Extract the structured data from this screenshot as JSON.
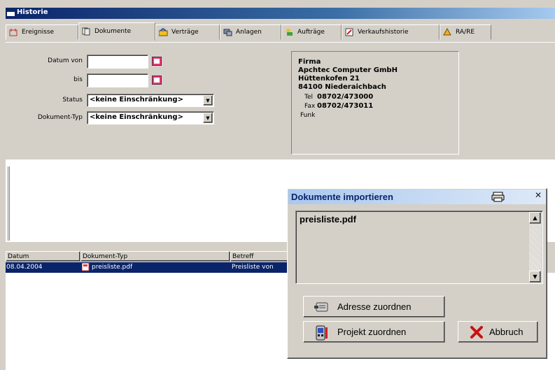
{
  "window": {
    "title": "Historie"
  },
  "tabs": [
    {
      "label": "Ereignisse",
      "icon": "events-icon"
    },
    {
      "label": "Dokumente",
      "icon": "documents-icon"
    },
    {
      "label": "Verträge",
      "icon": "contracts-icon"
    },
    {
      "label": "Anlagen",
      "icon": "assets-icon"
    },
    {
      "label": "Aufträge",
      "icon": "orders-icon"
    },
    {
      "label": "Verkaufshistorie",
      "icon": "sales-history-icon"
    },
    {
      "label": "RA/RE",
      "icon": "invoice-icon"
    }
  ],
  "filters": {
    "date_from_label": "Datum von",
    "date_to_label": "bis",
    "status_label": "Status",
    "doctype_label": "Dokument-Typ",
    "status_value": "<keine Einschränkung>",
    "doctype_value": "<keine Einschränkung>"
  },
  "firma": {
    "label": "Firma",
    "name": "Apchtec Computer GmbH",
    "street": "Hüttenkofen 21",
    "city": "84100  Niederaichbach",
    "tel_label": "Tel",
    "tel": "08702/473000",
    "fax_label": "Fax",
    "fax": "08702/473011",
    "funk_label": "Funk"
  },
  "table": {
    "columns": [
      "Datum",
      "Dokument-Typ",
      "Betreff"
    ],
    "rows": [
      {
        "datum": "08.04.2004",
        "typ": "preisliste.pdf",
        "betreff": "Preisliste von"
      }
    ]
  },
  "dialog": {
    "title": "Dokumente importieren",
    "items": [
      "preisliste.pdf"
    ],
    "buttons": {
      "address": "Adresse zuordnen",
      "project": "Projekt zuordnen",
      "cancel": "Abbruch"
    }
  },
  "colors": {
    "selection": "#0a246a",
    "window_bg": "#d4d0c8",
    "cancel_icon": "#cc1010"
  }
}
